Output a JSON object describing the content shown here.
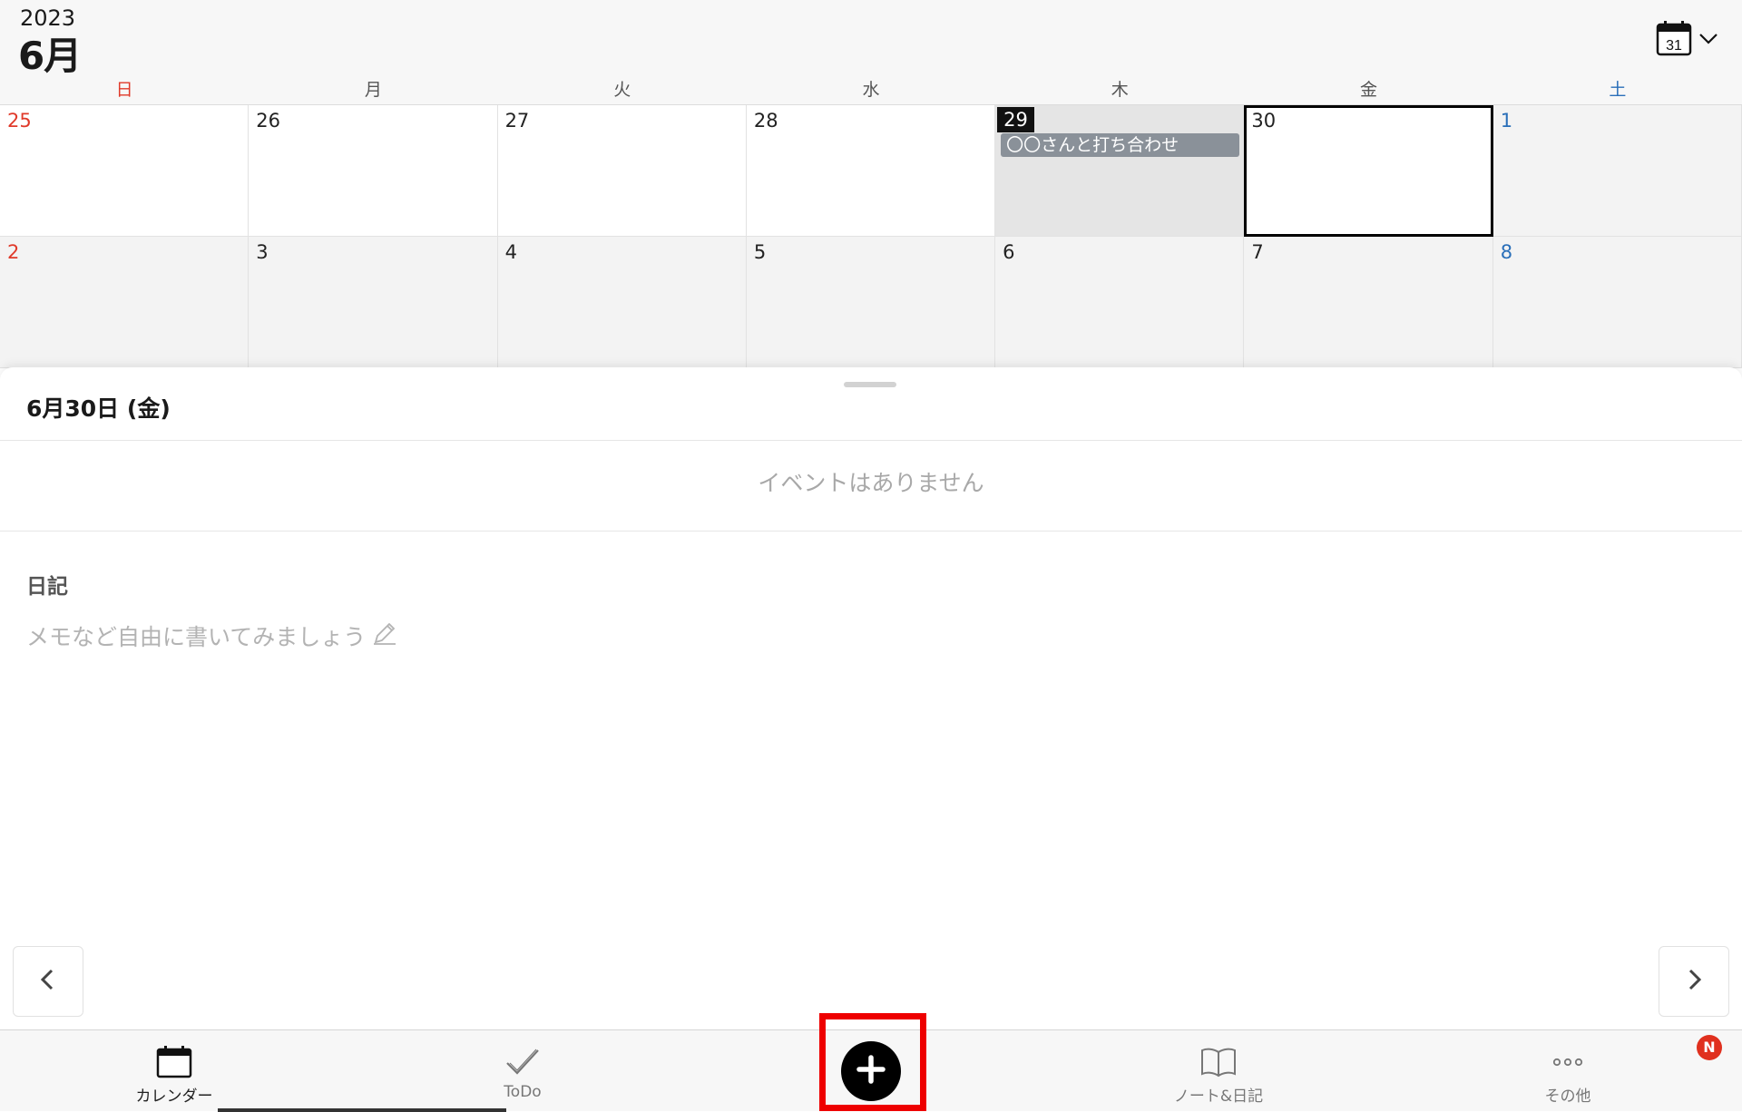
{
  "header": {
    "year": "2023",
    "month": "6月",
    "calendar_icon_day": "31"
  },
  "weekdays": [
    "日",
    "月",
    "火",
    "水",
    "木",
    "金",
    "土"
  ],
  "weeks": [
    [
      {
        "day": "25",
        "kind": "sun"
      },
      {
        "day": "26"
      },
      {
        "day": "27"
      },
      {
        "day": "28"
      },
      {
        "day": "29",
        "today": true,
        "event": "〇〇さんと打ち合わせ"
      },
      {
        "day": "30",
        "selected": true
      },
      {
        "day": "1",
        "kind": "sat",
        "dim": true
      }
    ],
    [
      {
        "day": "2",
        "kind": "sun",
        "dim": true
      },
      {
        "day": "3",
        "dim": true
      },
      {
        "day": "4",
        "dim": true
      },
      {
        "day": "5",
        "dim": true
      },
      {
        "day": "6",
        "dim": true
      },
      {
        "day": "7",
        "dim": true
      },
      {
        "day": "8",
        "kind": "sat",
        "dim": true
      }
    ]
  ],
  "sheet": {
    "selected_date": "6月30日 (金)",
    "no_events": "イベントはありません",
    "diary_title": "日記",
    "diary_placeholder": "メモなど自由に書いてみましょう"
  },
  "tabbar": {
    "calendar": "カレンダー",
    "todo": "ToDo",
    "note": "ノート&日記",
    "more": "その他",
    "badge": "N"
  },
  "colors": {
    "sunday": "#e03a2a",
    "saturday": "#2a6fb9",
    "highlight": "#ee0000",
    "event_chip": "#8a9199"
  }
}
